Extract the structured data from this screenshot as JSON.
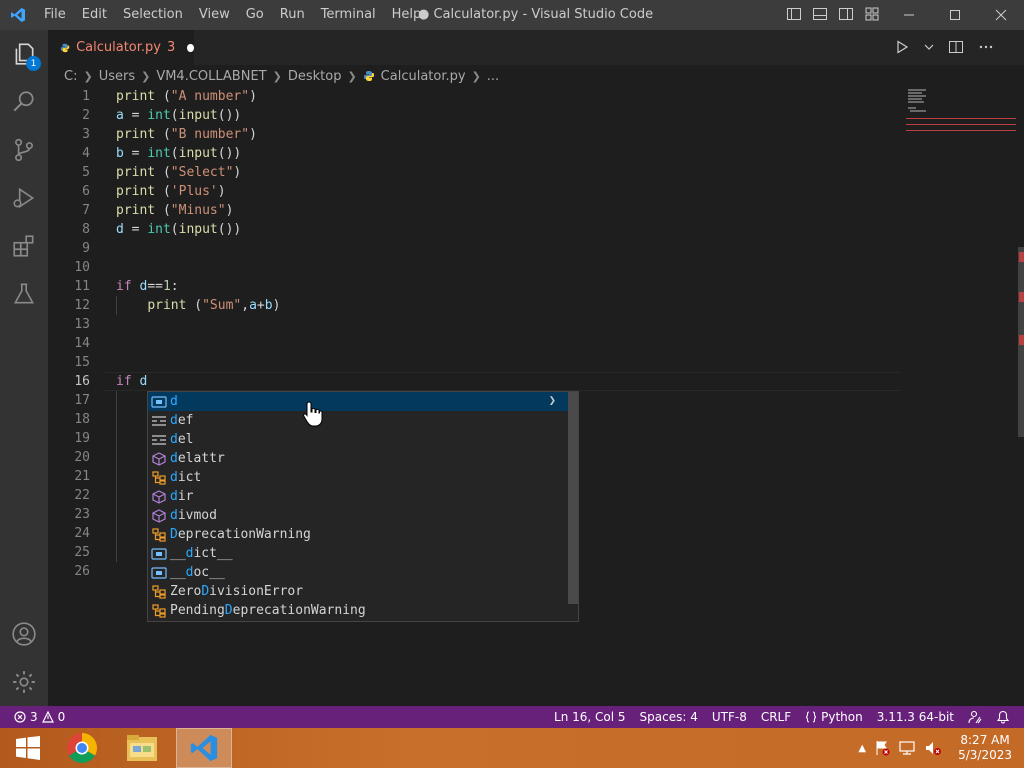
{
  "window": {
    "title": "● Calculator.py - Visual Studio Code",
    "menu": [
      "File",
      "Edit",
      "Selection",
      "View",
      "Go",
      "Run",
      "Terminal",
      "Help"
    ]
  },
  "activity": {
    "explorer_badge": "1",
    "icons": [
      "files-icon",
      "search-icon",
      "source-control-icon",
      "run-debug-icon",
      "extensions-icon",
      "testing-icon",
      "account-icon",
      "settings-gear-icon"
    ]
  },
  "tab": {
    "label": "Calculator.py",
    "problem_count": "3"
  },
  "breadcrumb": {
    "parts": [
      "C:",
      "Users",
      "VM4.COLLABNET",
      "Desktop",
      "Calculator.py",
      "..."
    ]
  },
  "editor": {
    "line_numbers": [
      "1",
      "2",
      "3",
      "4",
      "5",
      "6",
      "7",
      "8",
      "9",
      "10",
      "11",
      "12",
      "13",
      "14",
      "15",
      "16",
      "17",
      "18",
      "19",
      "20",
      "21",
      "22",
      "23",
      "24",
      "25",
      "26"
    ],
    "active_line": "16"
  },
  "suggest": {
    "items": [
      {
        "icon": "variable-icon",
        "hl": "d",
        "rest": "",
        "pre": ""
      },
      {
        "icon": "keyword-icon",
        "hl": "d",
        "rest": "ef",
        "pre": ""
      },
      {
        "icon": "keyword-icon",
        "hl": "d",
        "rest": "el",
        "pre": ""
      },
      {
        "icon": "function-icon",
        "hl": "d",
        "rest": "elattr",
        "pre": ""
      },
      {
        "icon": "class-icon",
        "hl": "d",
        "rest": "ict",
        "pre": ""
      },
      {
        "icon": "function-icon",
        "hl": "d",
        "rest": "ir",
        "pre": ""
      },
      {
        "icon": "function-icon",
        "hl": "d",
        "rest": "ivmod",
        "pre": ""
      },
      {
        "icon": "class-icon",
        "hl": "D",
        "rest": "eprecationWarning",
        "pre": ""
      },
      {
        "icon": "variable-icon",
        "hl": "d",
        "rest": "ict__",
        "pre": "__"
      },
      {
        "icon": "variable-icon",
        "hl": "d",
        "rest": "oc__",
        "pre": "__"
      },
      {
        "icon": "class-icon",
        "hl": "D",
        "rest": "ivisionError",
        "pre": "Zero"
      },
      {
        "icon": "class-icon",
        "hl": "D",
        "rest": "eprecationWarning",
        "pre": "Pending"
      }
    ]
  },
  "status": {
    "errors": "3",
    "warnings": "0",
    "position": "Ln 16, Col 5",
    "spaces": "Spaces: 4",
    "encoding": "UTF-8",
    "eol": "CRLF",
    "language": "Python",
    "interpreter": "3.11.3 64-bit"
  },
  "taskbar": {
    "time": "8:27 AM",
    "date": "5/3/2023"
  },
  "colors": {
    "status_bar": "#68217a",
    "taskbar": "#c36a27",
    "accent": "#0078d4"
  }
}
